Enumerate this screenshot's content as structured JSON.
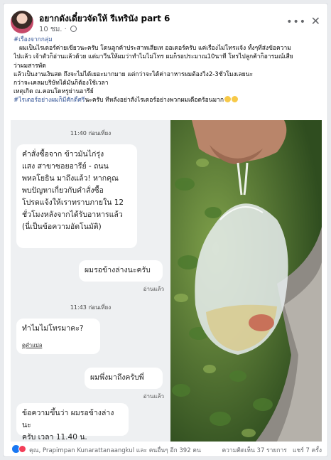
{
  "post": {
    "author": "อยากดังเดี๋ยวจัดให้ รีเทรินัง part 6",
    "time": "10 ชม.",
    "caption": {
      "hashtag1": "#เรื่องจากกลุ่ม",
      "lines": [
        "ผมเป็นไรเดอร์ค่ายเขียวนะครับ โดนลูกค้าประสาทเสียเท ออเดอร์ครับ แค่เรื่องไม่โทรแจ้ง ทั้งๆที่ส่งข้อความ",
        "ไปแล้ว เจ้าตัวก็อ่านแล้วด้วย แต่มาวีนให้ผมว่าทำไมไม่โทร ผมก็รอประมาณ10นาที โทรไปลูกค้าก็อารมณ์เสีย",
        "ว่าผมสารพัด",
        "แล้วเป็นงานเงินสด ถึงจะไม่ได้เยอะมากมาย แต่กว่าจะได้ค่าอาหารผมต้องวิ่ง2-3ชั่วโมงเลยนะ",
        "กว่าจะเคลมบริษัทได้มันก็ต้องใช้เวลา",
        "เหตุเกิด ณ.คอนโดหรูย่านอารีย์"
      ],
      "hashtag2": "#ไรเดอร์อย่างผมก็มีศักดิ์ศรี",
      "last_line": "นะครับ ทีหลังอย่าสั่งไรเดอร์อย่างพวกผมเดือดร้อนมาก"
    }
  },
  "chat": {
    "time1": "11:40 ก่อนเที่ยง",
    "msg1": "คำสั่งซื้อจาก ข้าวมันไก่รุ่งแสง สาขาซอยอารีย์ - ถนนพหลโยธิน มาถึงแล้ว! หากคุณพบปัญหาเกี่ยวกับคำสั่งซื้อ โปรดแจ้งให้เราทราบภายใน 12 ชั่วโมงหลังจากได้รับอาหารแล้ว (นี่เป็นข้อความอัตโนมัติ)",
    "msg1_lines": [
      "คำสั่งซื้อจาก ข้าวมันไก่รุ่ง",
      "แสง สาขาซอยอารีย์ - ถนน",
      "พหลโยธิน มาถึงแล้ว! หากคุณ",
      "พบปัญหาเกี่ยวกับคำสั่งซื้อ",
      "โปรดแจ้งให้เราทราบภายใน 12",
      "ชั่วโมงหลังจากได้รับอาหารแล้ว",
      "(นี่เป็นข้อความอัตโนมัติ)"
    ],
    "msg2": "ผมรอข้างล่างนะครับ",
    "read1": "อ่านแล้ว",
    "time2": "11:43 ก่อนเที่ยง",
    "msg3": "ทำไมไม่โทรมาคะ?",
    "msg3_link": "ดูคำแปล",
    "msg4": "ผมพึ่งมาถึงครับพี่",
    "read2": "อ่านแล้ว",
    "msg5_lines": [
      "ข้อความขึ้นว่า ผมรอข้างล่างนะ",
      "ครับ เวลา 11.40 น."
    ]
  },
  "footer": {
    "reactions_text": "คุณ, Prapimpan Kunarattanaangkul และ คนอื่นๆ อีก 392 คน",
    "comments": "ความคิดเห็น 37 รายการ",
    "shares": "แชร์ 7 ครั้ง"
  },
  "colors": {
    "hashtag": "#385898",
    "like": "#1877f2",
    "love": "#f33e58"
  },
  "icons": [
    "globe-icon",
    "more-icon",
    "close-icon",
    "like-reaction-icon",
    "love-reaction-icon"
  ]
}
